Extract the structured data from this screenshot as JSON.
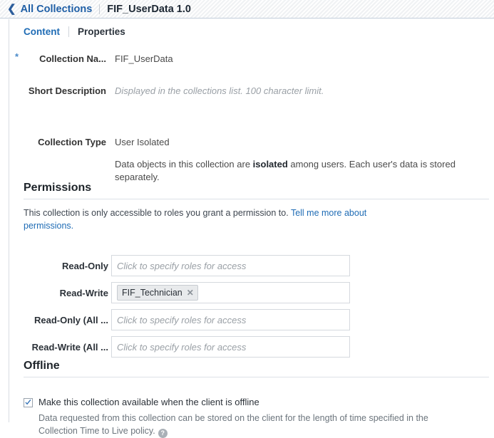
{
  "header": {
    "back_chevron": "chevron-left-icon",
    "back_label": "All Collections",
    "title": "FIF_UserData 1.0"
  },
  "tabs": [
    {
      "label": "Content",
      "active": true
    },
    {
      "label": "Properties",
      "active": false
    }
  ],
  "form": {
    "collection_name": {
      "required_marker": "*",
      "label": "Collection Na...",
      "value": "FIF_UserData"
    },
    "short_description": {
      "label": "Short Description",
      "placeholder": "Displayed in the collections list. 100 character limit."
    },
    "collection_type": {
      "label": "Collection Type",
      "value": "User Isolated",
      "description_prefix": "Data objects in this collection are ",
      "description_emphasis": "isolated",
      "description_suffix": " among users. Each user's data is stored separately."
    }
  },
  "permissions": {
    "title": "Permissions",
    "intro_text": "This collection is only accessible to roles you grant a permission to. ",
    "intro_link": "Tell me more about permissions.",
    "placeholder": "Click to specify roles for access",
    "rows": [
      {
        "label": "Read-Only",
        "chips": []
      },
      {
        "label": "Read-Write",
        "chips": [
          "FIF_Technician"
        ]
      },
      {
        "label": "Read-Only (All ...",
        "chips": []
      },
      {
        "label": "Read-Write (All ...",
        "chips": []
      }
    ],
    "chip_remove_icon": "close-icon"
  },
  "offline": {
    "title": "Offline",
    "checkbox_checked": true,
    "checkbox_label": "Make this collection available when the client is offline",
    "note": "Data requested from this collection can be stored on the client for the length of time specified in the Collection Time to Live policy.",
    "help_icon": "help-icon",
    "help_glyph": "?"
  },
  "colors": {
    "link": "#1f6cb5",
    "crumb": "#1f5fa6",
    "text": "#333333",
    "muted": "#9aa0a6",
    "border": "#d5d9de",
    "header_border": "#c3cedb"
  }
}
